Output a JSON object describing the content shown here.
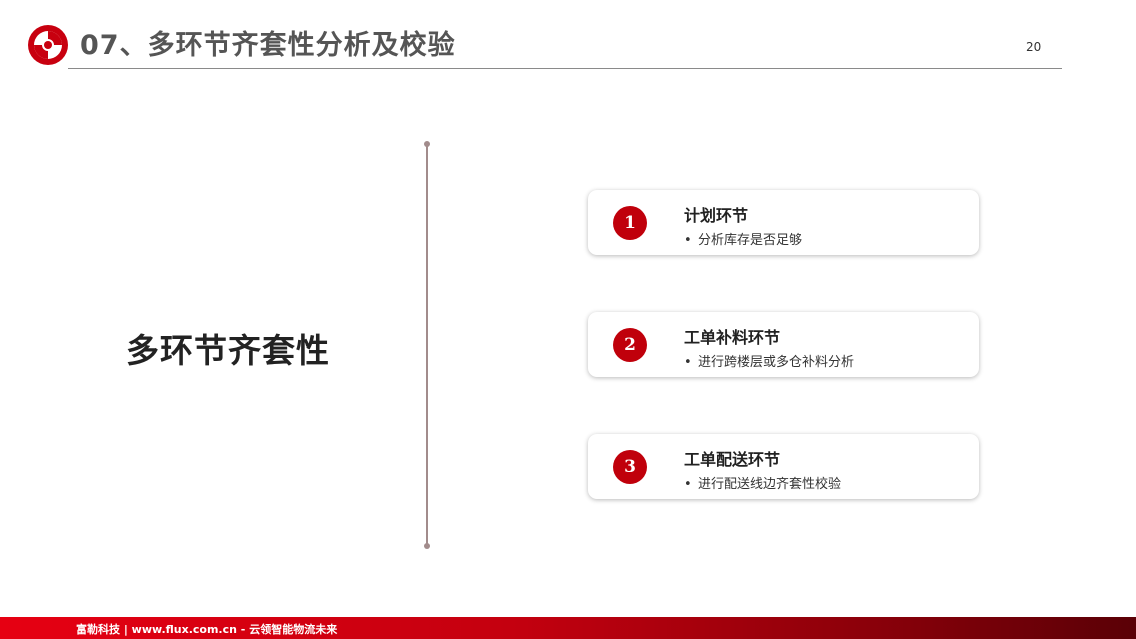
{
  "header": {
    "title": "07、多环节齐套性分析及校验",
    "page_number": "20"
  },
  "section_heading": "多环节齐套性",
  "cards": [
    {
      "number": "1",
      "title": "计划环节",
      "bullet": "分析库存是否足够"
    },
    {
      "number": "2",
      "title": "工单补料环节",
      "bullet": "进行跨楼层或多仓补料分析"
    },
    {
      "number": "3",
      "title": "工单配送环节",
      "bullet": "进行配送线边齐套性校验"
    }
  ],
  "bullet_symbol": "•",
  "footer": {
    "text": "富勒科技 | www.flux.com.cn  -  云领智能物流未来"
  },
  "colors": {
    "accent": "#c0000b",
    "footer_start": "#e60012",
    "footer_end": "#5a0006",
    "divider": "#a28c8c"
  }
}
